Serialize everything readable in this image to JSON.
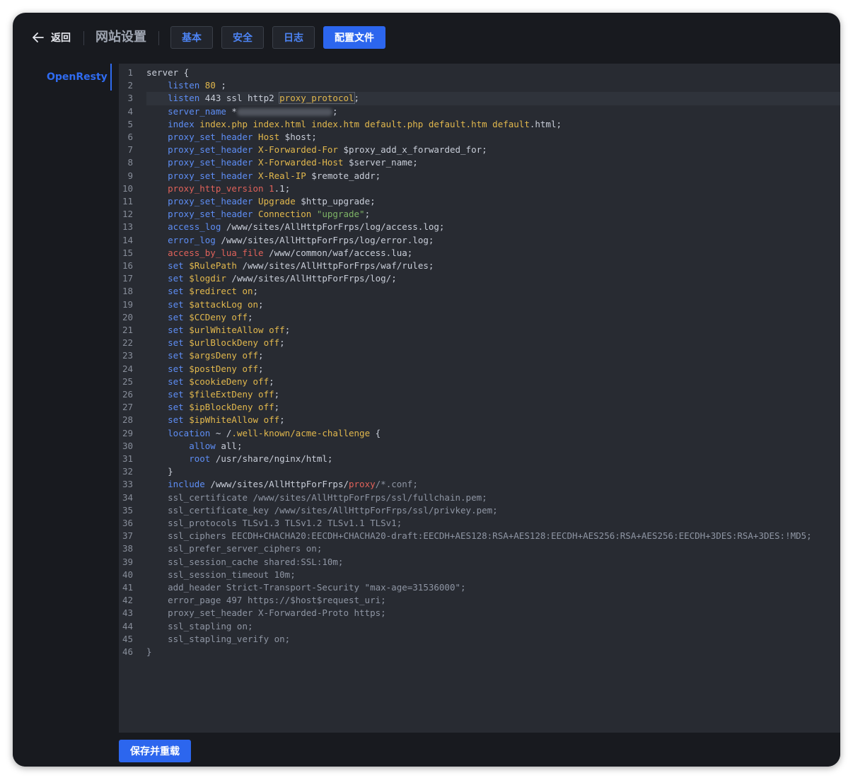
{
  "header": {
    "back_label": "返回",
    "page_title": "网站设置",
    "tabs": [
      {
        "label": "基本",
        "active": false
      },
      {
        "label": "安全",
        "active": false
      },
      {
        "label": "日志",
        "active": false
      },
      {
        "label": "配置文件",
        "active": true
      }
    ]
  },
  "sidebar": {
    "items": [
      {
        "label": "OpenResty",
        "active": true
      }
    ]
  },
  "editor": {
    "current_line": 3,
    "lines": [
      [
        [
          "w",
          "server {"
        ]
      ],
      [
        [
          "k",
          "    listen"
        ],
        [
          "p",
          " 80"
        ],
        [
          "w",
          " ;"
        ]
      ],
      [
        [
          "k",
          "    listen"
        ],
        [
          "w",
          " 443 ssl http2 "
        ],
        [
          "p",
          "proxy_protocol"
        ],
        [
          "w",
          ";"
        ]
      ],
      [
        [
          "k",
          "    server_name"
        ],
        [
          "w",
          " *"
        ],
        [
          "blur",
          ""
        ],
        [
          "w",
          ";"
        ]
      ],
      [
        [
          "k",
          "    index"
        ],
        [
          "p",
          " index.php index.html index.htm default.php default.htm default"
        ],
        [
          "w",
          ".html;"
        ]
      ],
      [
        [
          "k",
          "    proxy_set_header"
        ],
        [
          "p",
          " Host"
        ],
        [
          "w",
          " $host;"
        ]
      ],
      [
        [
          "k",
          "    proxy_set_header"
        ],
        [
          "p",
          " X-Forwarded-For"
        ],
        [
          "w",
          " $proxy_add_x_forwarded_for;"
        ]
      ],
      [
        [
          "k",
          "    proxy_set_header"
        ],
        [
          "p",
          " X-Forwarded-Host"
        ],
        [
          "w",
          " $server_name;"
        ]
      ],
      [
        [
          "k",
          "    proxy_set_header"
        ],
        [
          "p",
          " X-Real-IP"
        ],
        [
          "w",
          " $remote_addr;"
        ]
      ],
      [
        [
          "r",
          "    proxy_http_version"
        ],
        [
          "r",
          " 1"
        ],
        [
          "w",
          ".1;"
        ]
      ],
      [
        [
          "k",
          "    proxy_set_header"
        ],
        [
          "p",
          " Upgrade"
        ],
        [
          "w",
          " $http_upgrade;"
        ]
      ],
      [
        [
          "k",
          "    proxy_set_header"
        ],
        [
          "p",
          " Connection"
        ],
        [
          "s",
          " \"upgrade\""
        ],
        [
          "w",
          ";"
        ]
      ],
      [
        [
          "k",
          "    access_log"
        ],
        [
          "w",
          " /www/sites/AllHttpForFrps/log/access.log;"
        ]
      ],
      [
        [
          "k",
          "    error_log"
        ],
        [
          "w",
          " /www/sites/AllHttpForFrps/log/error.log;"
        ]
      ],
      [
        [
          "r",
          "    access_by_lua_file"
        ],
        [
          "w",
          " /www/common/waf/access.lua;"
        ]
      ],
      [
        [
          "k",
          "    set"
        ],
        [
          "p",
          " $RulePath"
        ],
        [
          "w",
          " /www/sites/AllHttpForFrps/waf/rules;"
        ]
      ],
      [
        [
          "k",
          "    set"
        ],
        [
          "p",
          " $logdir"
        ],
        [
          "w",
          " /www/sites/AllHttpForFrps/log/;"
        ]
      ],
      [
        [
          "k",
          "    set"
        ],
        [
          "p",
          " $redirect on"
        ],
        [
          "w",
          ";"
        ]
      ],
      [
        [
          "k",
          "    set"
        ],
        [
          "p",
          " $attackLog on"
        ],
        [
          "w",
          ";"
        ]
      ],
      [
        [
          "k",
          "    set"
        ],
        [
          "p",
          " $CCDeny off"
        ],
        [
          "w",
          ";"
        ]
      ],
      [
        [
          "k",
          "    set"
        ],
        [
          "p",
          " $urlWhiteAllow off"
        ],
        [
          "w",
          ";"
        ]
      ],
      [
        [
          "k",
          "    set"
        ],
        [
          "p",
          " $urlBlockDeny off"
        ],
        [
          "w",
          ";"
        ]
      ],
      [
        [
          "k",
          "    set"
        ],
        [
          "p",
          " $argsDeny off"
        ],
        [
          "w",
          ";"
        ]
      ],
      [
        [
          "k",
          "    set"
        ],
        [
          "p",
          " $postDeny off"
        ],
        [
          "w",
          ";"
        ]
      ],
      [
        [
          "k",
          "    set"
        ],
        [
          "p",
          " $cookieDeny off"
        ],
        [
          "w",
          ";"
        ]
      ],
      [
        [
          "k",
          "    set"
        ],
        [
          "p",
          " $fileExtDeny off"
        ],
        [
          "w",
          ";"
        ]
      ],
      [
        [
          "k",
          "    set"
        ],
        [
          "p",
          " $ipBlockDeny off"
        ],
        [
          "w",
          ";"
        ]
      ],
      [
        [
          "k",
          "    set"
        ],
        [
          "p",
          " $ipWhiteAllow off"
        ],
        [
          "w",
          ";"
        ]
      ],
      [
        [
          "k",
          "    location"
        ],
        [
          "w",
          " ~ /"
        ],
        [
          "p",
          ".well-known/acme-challenge"
        ],
        [
          "w",
          " {"
        ]
      ],
      [
        [
          "k",
          "        allow"
        ],
        [
          "w",
          " all;"
        ]
      ],
      [
        [
          "k",
          "        root"
        ],
        [
          "w",
          " /usr/share/nginx/html;"
        ]
      ],
      [
        [
          "w",
          "    }"
        ]
      ],
      [
        [
          "k",
          "    include"
        ],
        [
          "w",
          " /www/sites/AllHttpForFrps/"
        ],
        [
          "r",
          "proxy"
        ],
        [
          "g",
          "/*.conf;"
        ]
      ],
      [
        [
          "g",
          "    ssl_certificate /www/sites/AllHttpForFrps/ssl/fullchain.pem;"
        ]
      ],
      [
        [
          "g",
          "    ssl_certificate_key /www/sites/AllHttpForFrps/ssl/privkey.pem;"
        ]
      ],
      [
        [
          "g",
          "    ssl_protocols TLSv1.3 TLSv1.2 TLSv1.1 TLSv1;"
        ]
      ],
      [
        [
          "g",
          "    ssl_ciphers EECDH+CHACHA20:EECDH+CHACHA20-draft:EECDH+AES128:RSA+AES128:EECDH+AES256:RSA+AES256:EECDH+3DES:RSA+3DES:!MD5;"
        ]
      ],
      [
        [
          "g",
          "    ssl_prefer_server_ciphers on;"
        ]
      ],
      [
        [
          "g",
          "    ssl_session_cache shared:SSL:10m;"
        ]
      ],
      [
        [
          "g",
          "    ssl_session_timeout 10m;"
        ]
      ],
      [
        [
          "g",
          "    add_header Strict-Transport-Security \"max-age=31536000\";"
        ]
      ],
      [
        [
          "g",
          "    error_page 497 https://$host$request_uri;"
        ]
      ],
      [
        [
          "g",
          "    proxy_set_header X-Forwarded-Proto https;"
        ]
      ],
      [
        [
          "g",
          "    ssl_stapling on;"
        ]
      ],
      [
        [
          "g",
          "    ssl_stapling_verify on;"
        ]
      ],
      [
        [
          "g",
          "}"
        ]
      ]
    ]
  },
  "footer": {
    "save_label": "保存并重载"
  },
  "colors": {
    "accent": "#2c66ee",
    "background": "#181a1f",
    "editor_bg": "#282b32"
  }
}
